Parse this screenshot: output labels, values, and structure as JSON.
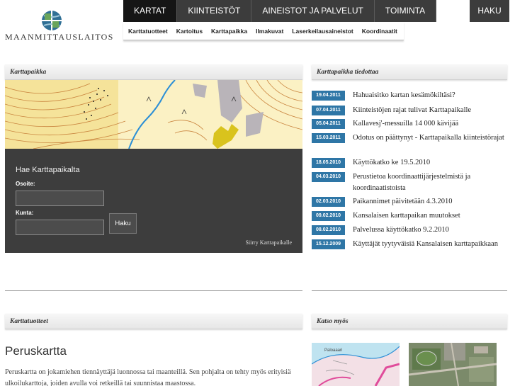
{
  "header": {
    "logo_text": "MAANMITTAUSLAITOS",
    "main_nav": [
      "KARTAT",
      "KIINTEISTÖT",
      "AINEISTOT JA PALVELUT",
      "TOIMINTA"
    ],
    "search_label": "HAKU",
    "sub_nav": [
      "Karttatuotteet",
      "Kartoitus",
      "Karttapaikka",
      "Ilmakuvat",
      "Laserkeilausaineistot",
      "Koordinaatit"
    ]
  },
  "karttapaikka": {
    "section_title": "Karttapaikka",
    "search_title": "Hae Karttapaikalta",
    "address_label": "Osoite:",
    "municipality_label": "Kunta:",
    "search_button": "Haku",
    "goto_link": "Siirry Karttapaikalle"
  },
  "news": {
    "section_title": "Karttapaikka tiedottaa",
    "items": [
      {
        "date": "19.04.2011",
        "text": "Hahuaisitko kartan kesämökiltäsi?"
      },
      {
        "date": "07.04.2011",
        "text": "Kiinteistöjen rajat tulivat Karttapaikalle"
      },
      {
        "date": "05.04.2011",
        "text": "Kallavesj'-messuilla 14 000 kävijää"
      },
      {
        "date": "15.03.2011",
        "text": "Odotus on päättynyt - Karttapaikalla kiinteistörajat"
      },
      {
        "date": "18.05.2010",
        "text": "Käyttökatko ke 19.5.2010"
      },
      {
        "date": "04.03.2010",
        "text": "Perustietoa koordinaattijärjestelmistä ja koordinaatistoista"
      },
      {
        "date": "02.03.2010",
        "text": "Paikannimet päivitetään 4.3.2010"
      },
      {
        "date": "09.02.2010",
        "text": "Kansalaisen karttapaikan muutokset"
      },
      {
        "date": "08.02.2010",
        "text": "Palvelussa käyttökatko 9.2.2010"
      },
      {
        "date": "15.12.2009",
        "text": "Käyttäjät tyytyväisiä Kansalaisen karttapaikkaan"
      }
    ]
  },
  "karttatuotteet": {
    "section_title": "Karttatuotteet",
    "heading": "Peruskartta",
    "description": "Peruskartta on jokamiehen tiennäyttäjä luonnossa tai maanteillä. Sen pohjalta on tehty myös erityisiä ulkoilukarttoja, joiden avulla voi retkeillä tai suunnistaa maastossa."
  },
  "katso_myos": {
    "section_title": "Katso myös",
    "map_label": "Paloaaari"
  },
  "colors": {
    "nav_bg": "#3c3c3c",
    "nav_active": "#151515",
    "date_badge": "#2e76a6",
    "search_panel": "#3d3d3d"
  }
}
